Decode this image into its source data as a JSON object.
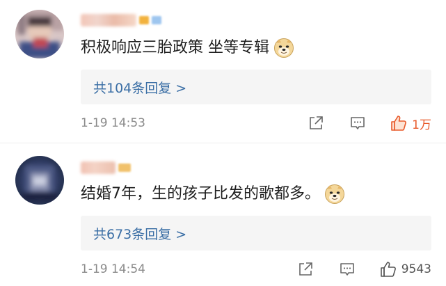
{
  "comments": [
    {
      "text": "积极响应三胎政策 坐等专辑",
      "emoji": "doge-emoji",
      "replies_link": "共104条回复 >",
      "timestamp": "1-19 14:53",
      "likes": "1万",
      "liked": true,
      "icons": {
        "share": "share-icon",
        "reply": "reply-icon",
        "like": "thumbs-up-icon"
      }
    },
    {
      "text": "结婚7年，生的孩子比发的歌都多。",
      "emoji": "doge-emoji",
      "replies_link": "共673条回复 >",
      "timestamp": "1-19 14:54",
      "likes": "9543",
      "liked": false,
      "icons": {
        "share": "share-icon",
        "reply": "reply-icon",
        "like": "thumbs-up-icon"
      }
    }
  ],
  "colors": {
    "link": "#3a6ea5",
    "liked": "#e85a2a",
    "timestamp": "#8a8a8a",
    "replies_background": "#f5f5f5"
  }
}
